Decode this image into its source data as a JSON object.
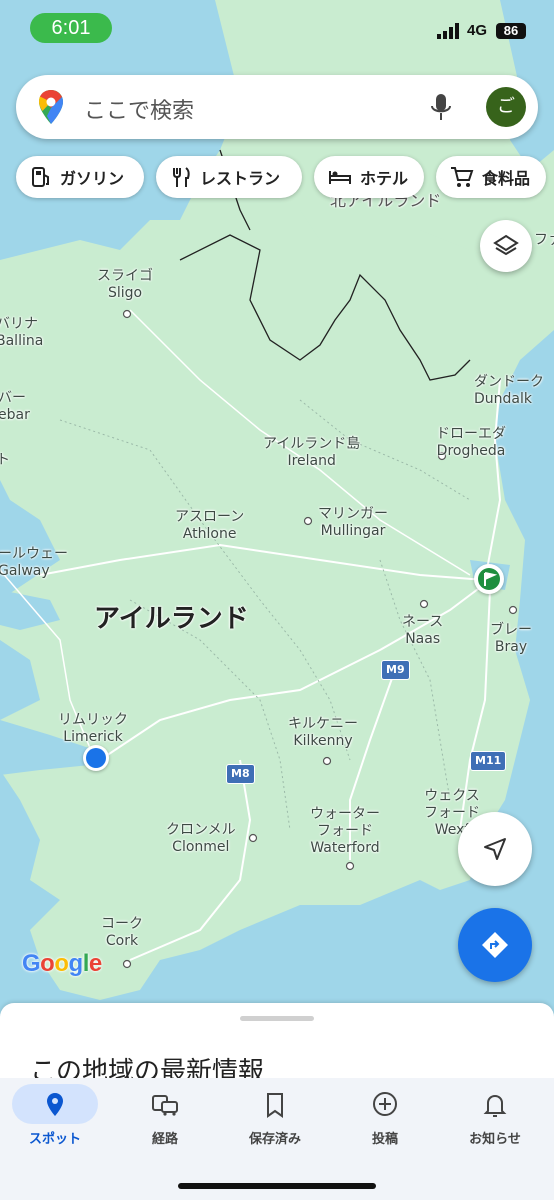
{
  "status_bar": {
    "time": "6:01",
    "network": "4G",
    "battery": "86"
  },
  "search": {
    "placeholder": "ここで検索",
    "avatar_letter": "ご"
  },
  "chips": [
    {
      "label": "ガソリン",
      "icon": "gas-station-icon"
    },
    {
      "label": "レストラン",
      "icon": "restaurant-icon"
    },
    {
      "label": "ホテル",
      "icon": "hotel-icon"
    },
    {
      "label": "食料品",
      "icon": "grocery-cart-icon"
    }
  ],
  "map": {
    "country": "アイルランド",
    "region_ni": "北アイルランド",
    "places": [
      {
        "jp": "スライゴ",
        "en": "Sligo"
      },
      {
        "jp": "バリナ",
        "en": "Ballina"
      },
      {
        "jp": "バー",
        "en": "ebar"
      },
      {
        "jp": "ト",
        "en": ""
      },
      {
        "jp": "ダンドーク",
        "en": "Dundalk"
      },
      {
        "jp": "アイルランド島",
        "en": "Ireland"
      },
      {
        "jp": "ドローエダ",
        "en": "Drogheda"
      },
      {
        "jp": "アスローン",
        "en": "Athlone"
      },
      {
        "jp": "マリンガー",
        "en": "Mullingar"
      },
      {
        "jp": "ールウェー",
        "en": "Galway"
      },
      {
        "jp": "ネース",
        "en": "Naas"
      },
      {
        "jp": "ブレー",
        "en": "Bray"
      },
      {
        "jp": "リムリック",
        "en": "Limerick"
      },
      {
        "jp": "キルケニー",
        "en": "Kilkenny"
      },
      {
        "jp": "ウォーター\nフォード",
        "en": "Waterford"
      },
      {
        "jp": "ウェクス\nフォード",
        "en": "Wexf"
      },
      {
        "jp": "クロンメル",
        "en": "Clonmel"
      },
      {
        "jp": "コーク",
        "en": "Cork"
      },
      {
        "jp": "ファ",
        "en": ""
      }
    ],
    "shields": [
      "M9",
      "M8",
      "M11"
    ],
    "attribution": "Google"
  },
  "sheet": {
    "title": "この地域の最新情報"
  },
  "nav": [
    {
      "label": "スポット",
      "icon": "location-pin-icon",
      "active": true
    },
    {
      "label": "経路",
      "icon": "commute-icon",
      "active": false
    },
    {
      "label": "保存済み",
      "icon": "bookmark-icon",
      "active": false
    },
    {
      "label": "投稿",
      "icon": "add-circle-icon",
      "active": false
    },
    {
      "label": "お知らせ",
      "icon": "bell-icon",
      "active": false
    }
  ],
  "colors": {
    "water": "#9fd6e9",
    "land": "#c9ecd0",
    "accent": "#1a73e8",
    "chip_text": "#222222"
  }
}
